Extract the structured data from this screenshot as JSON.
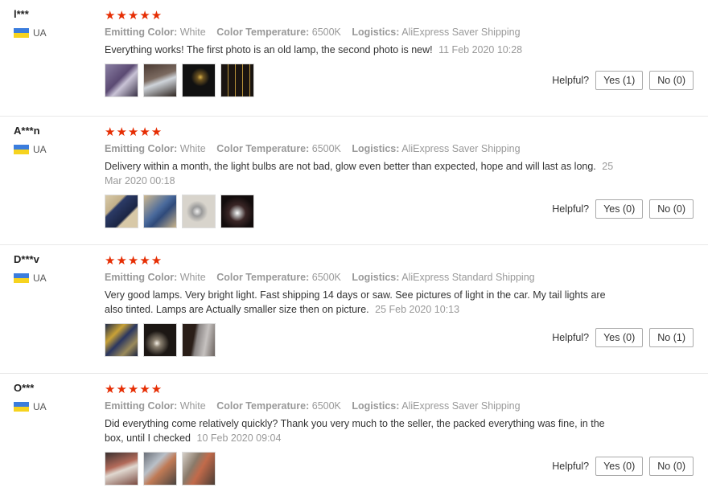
{
  "colors": {
    "star": "#e62e04",
    "flag_blue": "#3b7ddd",
    "flag_yellow": "#f6d31f"
  },
  "labels": {
    "emitting_color": "Emitting Color:",
    "color_temperature": "Color Temperature:",
    "logistics": "Logistics:",
    "helpful": "Helpful?"
  },
  "reviews": [
    {
      "user": "l***",
      "country": "UA",
      "rating": 5,
      "emitting_color": "White",
      "color_temperature": "6500K",
      "logistics": "AliExpress Saver Shipping",
      "text": "Everything works! The first photo is an old lamp, the second photo is new!",
      "date": "11 Feb 2020 10:28",
      "photo_count": 4,
      "yes": "Yes (1)",
      "no": "No (0)"
    },
    {
      "user": "A***n",
      "country": "UA",
      "rating": 5,
      "emitting_color": "White",
      "color_temperature": "6500K",
      "logistics": "AliExpress Saver Shipping",
      "text": "Delivery within a month, the light bulbs are not bad, glow even better than expected, hope and will last as long.",
      "date": "25 Mar 2020 00:18",
      "photo_count": 4,
      "yes": "Yes (0)",
      "no": "No (0)"
    },
    {
      "user": "D***v",
      "country": "UA",
      "rating": 4.8,
      "emitting_color": "White",
      "color_temperature": "6500K",
      "logistics": "AliExpress Standard Shipping",
      "text": "Very good lamps. Very bright light. Fast shipping 14 days or saw. See pictures of light in the car. My tail lights are also tinted. Lamps are Actually smaller size then on picture.",
      "date": "25 Feb 2020 10:13",
      "photo_count": 3,
      "yes": "Yes (0)",
      "no": "No (1)"
    },
    {
      "user": "O***",
      "country": "UA",
      "rating": 5,
      "emitting_color": "White",
      "color_temperature": "6500K",
      "logistics": "AliExpress Saver Shipping",
      "text": "Did everything come relatively quickly? Thank you very much to the seller, the packed everything was fine, in the box, until I checked",
      "date": "10 Feb 2020 09:04",
      "photo_count": 3,
      "yes": "Yes (0)",
      "no": "No (0)"
    }
  ]
}
